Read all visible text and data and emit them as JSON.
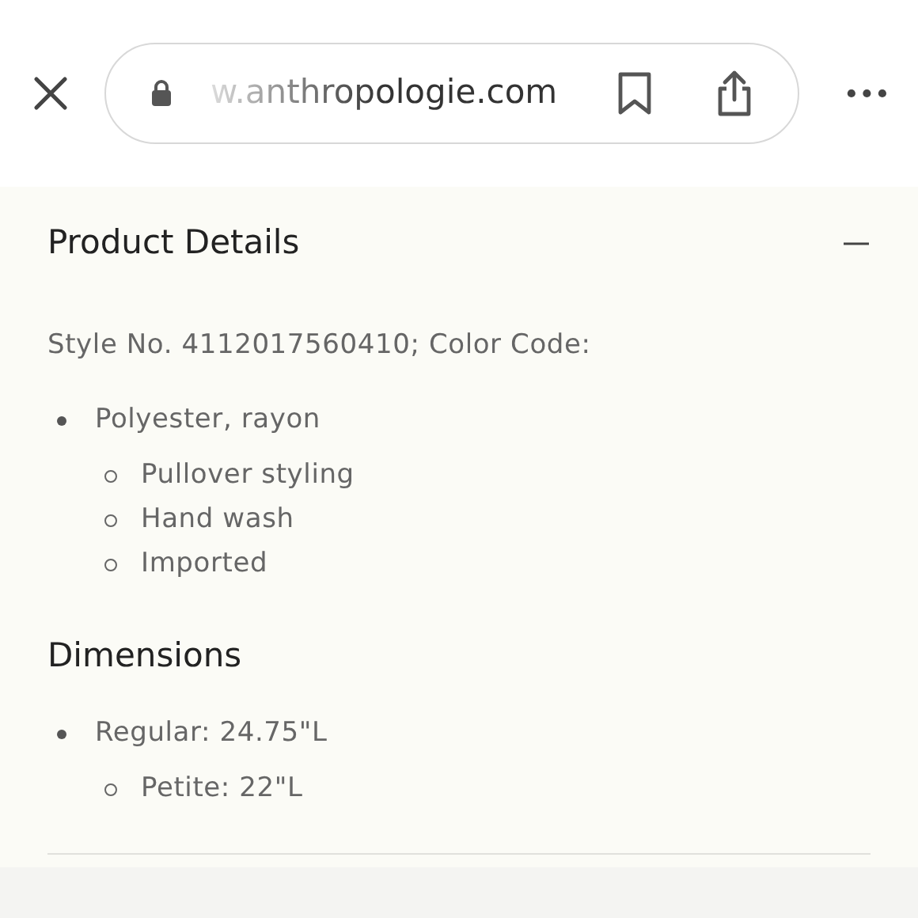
{
  "browser_bar": {
    "url": "w.anthropologie.com"
  },
  "sections": [
    {
      "title": "Product Details",
      "expanded": true,
      "description": "Style No. 4112017560410; Color Code:",
      "items": [
        {
          "text": "Polyester, rayon",
          "children": [
            {
              "text": "Pullover styling"
            },
            {
              "text": "Hand wash"
            },
            {
              "text": "Imported"
            }
          ]
        }
      ]
    },
    {
      "title": "Dimensions",
      "items": [
        {
          "text": "Regular: 24.75\"L",
          "children": [
            {
              "text": "Petite: 22\"L"
            }
          ]
        }
      ]
    }
  ]
}
